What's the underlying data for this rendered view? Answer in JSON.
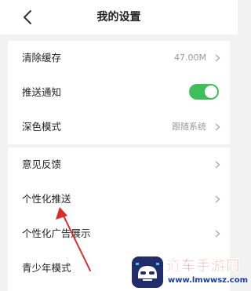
{
  "header": {
    "title": "我的设置"
  },
  "section1": {
    "items": [
      {
        "label": "清除缓存",
        "value": "47.00M"
      },
      {
        "label": "推送通知",
        "toggle_on": true
      },
      {
        "label": "深色模式",
        "value": "跟随系统"
      }
    ]
  },
  "section2": {
    "items": [
      {
        "label": "意见反馈"
      },
      {
        "label": "个性化推送"
      },
      {
        "label": "个性化广告展示"
      },
      {
        "label": "青少年模式"
      }
    ]
  },
  "colors": {
    "toggle_on": "#3fbf5a",
    "arrow": "#e02a2a",
    "background": "#f2f2f2"
  },
  "watermark": {
    "title": "道车手游网",
    "url": "www.lmwwsz.com"
  }
}
